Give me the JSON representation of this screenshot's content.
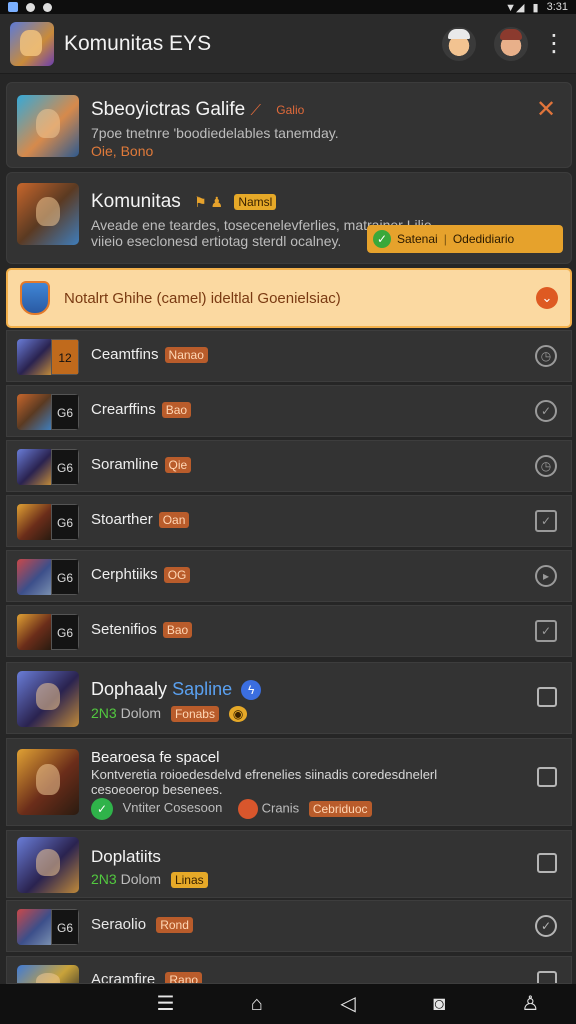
{
  "status": {
    "time": "3:31"
  },
  "header": {
    "title": "Komunitas EYS"
  },
  "cards": [
    {
      "title": "Sbeoyictras Galife",
      "tag": "Galio",
      "line1": "7poe tnetnre 'boodiedelables tanemday.",
      "line2": "Oie, Bono"
    },
    {
      "title": "Komunitas",
      "tag": "Namsl",
      "line1": "Aveade ene teardes, tosecenelevferlies, matrainer Lilie",
      "line2": "viieio eseclonesd ertiotag sterdl ocalney.",
      "pill_left": "Satenai",
      "pill_right": "Odedidiario"
    }
  ],
  "banner": {
    "text": "Notalrt Ghihe (camel) ideltlal Goenielsiac)"
  },
  "rows": [
    {
      "label": "Ceamtfins",
      "badge": "Nanao",
      "num": "12",
      "status": "clock"
    },
    {
      "label": "Crearffins",
      "badge": "Bao",
      "num": "G6",
      "status": "check-circle"
    },
    {
      "label": "Soramline",
      "badge": "Qie",
      "num": "G6",
      "status": "clock"
    },
    {
      "label": "Stoarther",
      "badge": "Oan",
      "num": "G6",
      "status": "checkbox"
    },
    {
      "label": "Cerphtiiks",
      "badge": "OG",
      "num": "G6",
      "status": "play"
    },
    {
      "label": "Setenifios",
      "badge": "Bao",
      "num": "G6",
      "status": "checkbox"
    }
  ],
  "posts": [
    {
      "title": "Dophaaly",
      "highlight": "Sapline",
      "meta_num": "2N3",
      "meta_text": "Dolom",
      "tag": "Fonabs"
    },
    {
      "title": "Bearoesa fe spacel",
      "body1": "Kontveretia roioedesdelvd efrenelies siinadis coredesdnelerl",
      "body2": "cesoeoerop besenees.",
      "footer_a": "Vntiter Cosesoon",
      "footer_b": "Cranis",
      "footer_tag": "Cebriduoc"
    },
    {
      "title": "Doplatiits",
      "meta_num": "2N3",
      "meta_text": "Dolom",
      "tag": "Linas"
    },
    {
      "label": "Seraolio",
      "badge": "Rond",
      "num": "G6"
    },
    {
      "label": "Acramfire",
      "badge": "Rano"
    }
  ],
  "nav": [
    "menu",
    "home",
    "back",
    "game",
    "profile"
  ]
}
